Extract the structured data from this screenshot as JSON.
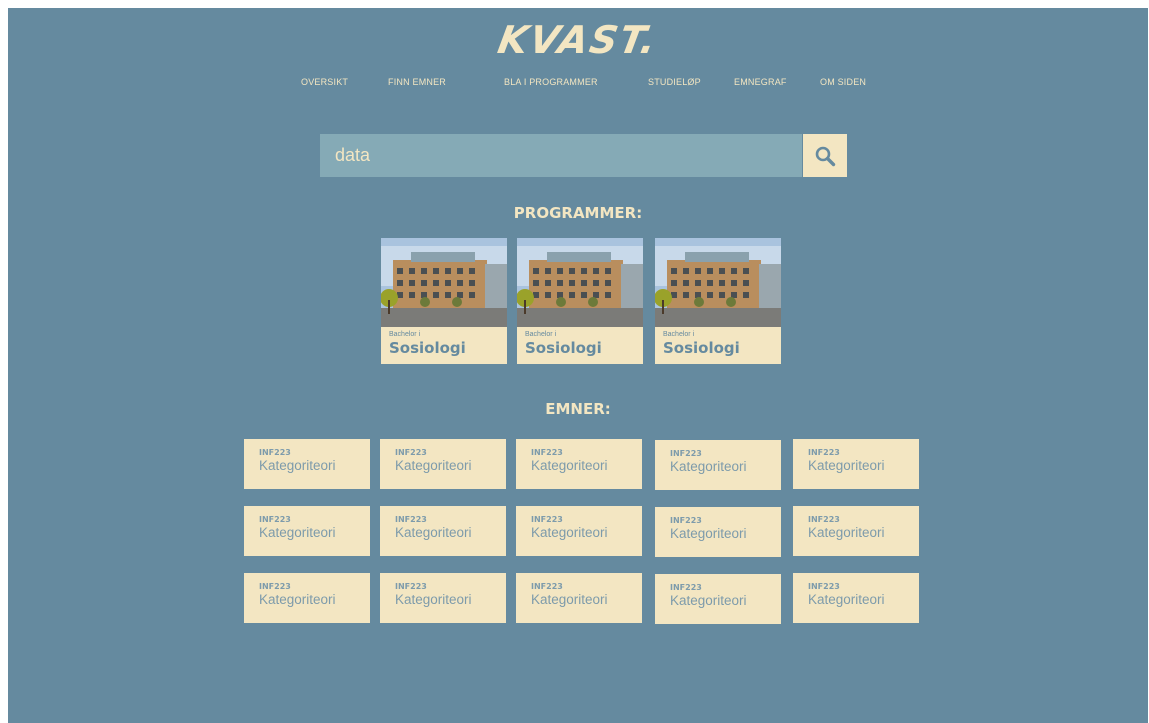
{
  "header": {
    "logo_text": "KVAST."
  },
  "nav": [
    {
      "label": "OVERSIKT"
    },
    {
      "label": "FINN EMNER"
    },
    {
      "label": "BLA I PROGRAMMER"
    },
    {
      "label": "STUDIELØP"
    },
    {
      "label": "EMNEGRAF"
    },
    {
      "label": "OM SIDEN"
    }
  ],
  "search": {
    "value": "data",
    "icon": "search-icon"
  },
  "programs_section": {
    "title": "PROGRAMMER:",
    "items": [
      {
        "subtitle": "Bachelor i",
        "name": "Sosiologi"
      },
      {
        "subtitle": "Bachelor i",
        "name": "Sosiologi"
      },
      {
        "subtitle": "Bachelor i",
        "name": "Sosiologi"
      }
    ]
  },
  "courses_section": {
    "title": "EMNER:",
    "items": [
      {
        "code": "INF223",
        "name": "Kategoriteori"
      },
      {
        "code": "INF223",
        "name": "Kategoriteori"
      },
      {
        "code": "INF223",
        "name": "Kategoriteori"
      },
      {
        "code": "INF223",
        "name": "Kategoriteori"
      },
      {
        "code": "INF223",
        "name": "Kategoriteori"
      },
      {
        "code": "INF223",
        "name": "Kategoriteori"
      },
      {
        "code": "INF223",
        "name": "Kategoriteori"
      },
      {
        "code": "INF223",
        "name": "Kategoriteori"
      },
      {
        "code": "INF223",
        "name": "Kategoriteori"
      },
      {
        "code": "INF223",
        "name": "Kategoriteori"
      },
      {
        "code": "INF223",
        "name": "Kategoriteori"
      },
      {
        "code": "INF223",
        "name": "Kategoriteori"
      },
      {
        "code": "INF223",
        "name": "Kategoriteori"
      },
      {
        "code": "INF223",
        "name": "Kategoriteori"
      },
      {
        "code": "INF223",
        "name": "Kategoriteori"
      }
    ]
  },
  "colors": {
    "background": "#658a9f",
    "cream": "#f3e6c2",
    "search_bg": "#85aab6",
    "muted_text": "#7d9bab"
  }
}
